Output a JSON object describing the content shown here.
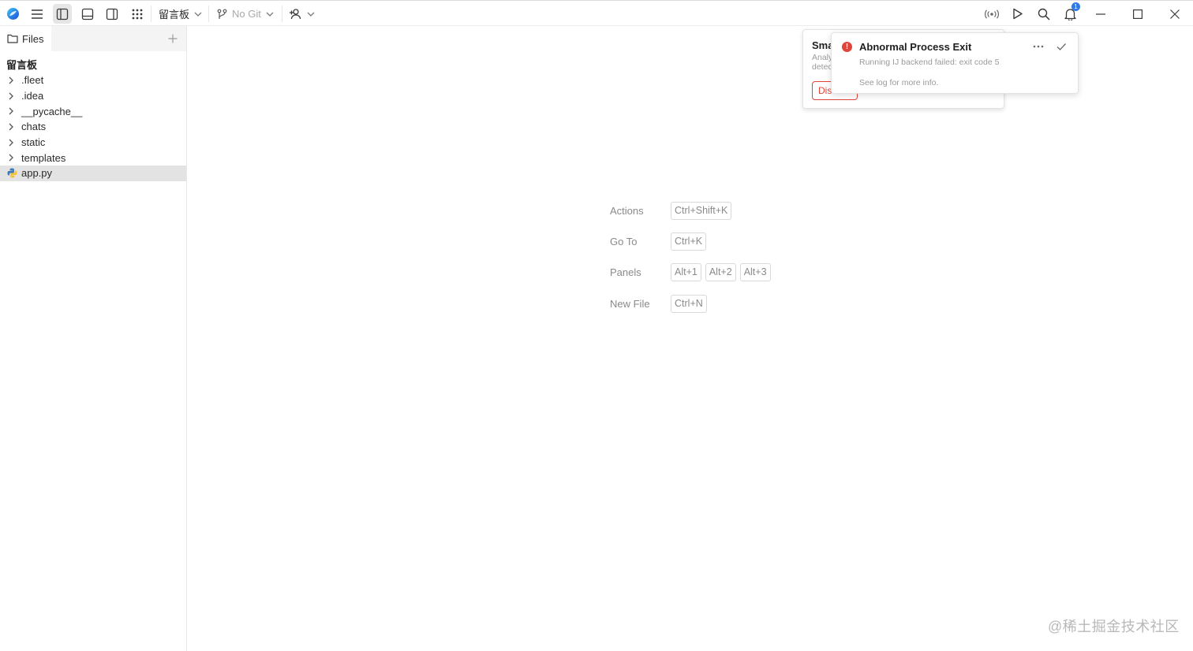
{
  "toolbar": {
    "project_dropdown": "留言板",
    "git_dropdown": "No Git",
    "notification_count": "1"
  },
  "sidebar": {
    "tab_label": "Files",
    "project_name": "留言板",
    "tree": [
      {
        "label": ".fleet",
        "type": "folder"
      },
      {
        "label": ".idea",
        "type": "folder"
      },
      {
        "label": "__pycache__",
        "type": "folder"
      },
      {
        "label": "chats",
        "type": "folder"
      },
      {
        "label": "static",
        "type": "folder"
      },
      {
        "label": "templates",
        "type": "folder"
      },
      {
        "label": "app.py",
        "type": "python-file",
        "selected": true
      }
    ]
  },
  "shortcuts": [
    {
      "label": "Actions",
      "keys": [
        "Ctrl+Shift+K"
      ]
    },
    {
      "label": "Go To",
      "keys": [
        "Ctrl+K"
      ]
    },
    {
      "label": "Panels",
      "keys": [
        "Alt+1",
        "Alt+2",
        "Alt+3"
      ]
    },
    {
      "label": "New File",
      "keys": [
        "Ctrl+N"
      ]
    }
  ],
  "notifications": {
    "back": {
      "title_fragment": "Sma",
      "text_fragment_1": "Analy",
      "text_fragment_2": "detec",
      "button_fragment": "Dis"
    },
    "front": {
      "title": "Abnormal Process Exit",
      "message": "Running IJ backend failed: exit code 5",
      "log_link": "See log for more info."
    }
  },
  "watermark": "@稀土掘金技术社区",
  "colors": {
    "error": "#e0453b",
    "badge": "#2f7ae5",
    "selection": "#e3e3e3"
  }
}
